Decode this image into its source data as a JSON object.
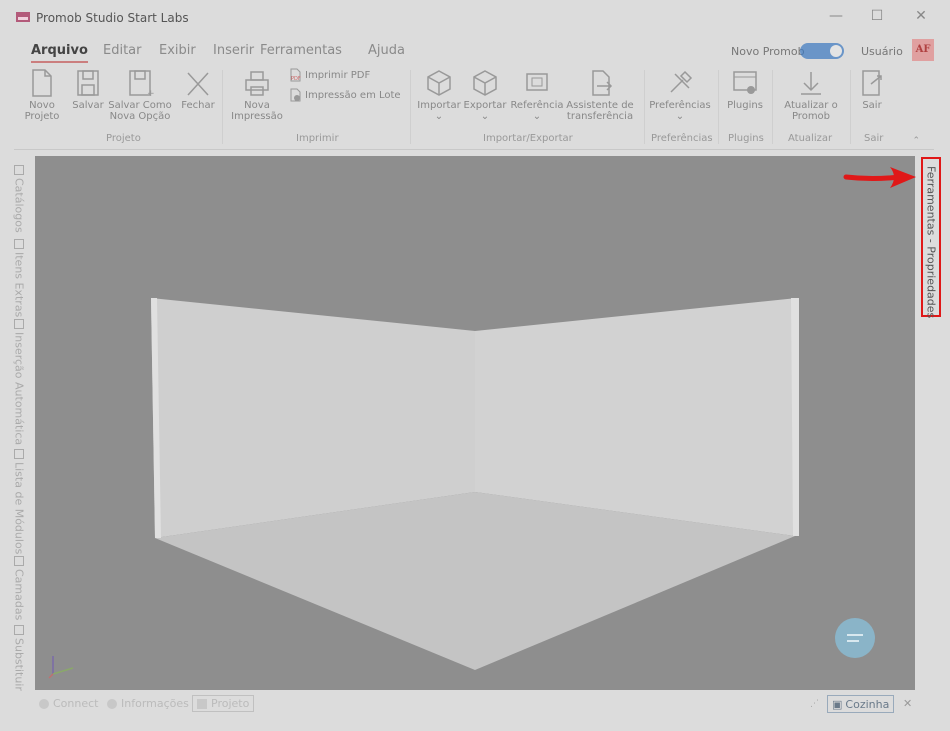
{
  "window": {
    "title": "Promob Studio Start Labs",
    "minimize": "—",
    "maximize": "☐",
    "close": "✕"
  },
  "menu": {
    "items": [
      "Arquivo",
      "Editar",
      "Exibir",
      "Inserir",
      "Ferramentas",
      "Ajuda"
    ],
    "novo_promob": "Novo Promob",
    "novo_promob_enabled": true,
    "user": "Usuário",
    "avatar": "AF"
  },
  "ribbon": {
    "projeto": {
      "novo": [
        "Novo",
        "Projeto"
      ],
      "salvar": "Salvar",
      "salvar_como": [
        "Salvar Como",
        "Nova Opção"
      ],
      "fechar": "Fechar",
      "group": "Projeto"
    },
    "imprimir": {
      "nova": [
        "Nova",
        "Impressão"
      ],
      "pdf": "Imprimir PDF",
      "lote": "Impressão em Lote",
      "group": "Imprimir"
    },
    "importar": {
      "importar": "Importar",
      "exportar": "Exportar",
      "referencia": "Referência",
      "assistente": [
        "Assistente de",
        "transferência"
      ],
      "group": "Importar/Exportar"
    },
    "preferencias": {
      "label": "Preferências",
      "group": "Preferências"
    },
    "plugins": {
      "label": "Plugins",
      "group": "Plugins"
    },
    "atualizar": {
      "label": [
        "Atualizar o",
        "Promob"
      ],
      "group": "Atualizar"
    },
    "sair": {
      "label": "Sair",
      "group": "Sair"
    }
  },
  "left_tabs": [
    "Catálogos",
    "Itens Extras",
    "Inserção Automática",
    "Lista de Módulos",
    "Camadas",
    "Substituir"
  ],
  "right_tab": {
    "label": "Ferramentas - Propriedades"
  },
  "bottom_tabs": [
    "Connect",
    "Informações",
    "Projeto"
  ],
  "bottom_active": "Projeto",
  "environment": {
    "label": "Cozinha",
    "close": "✕"
  },
  "colors": {
    "viewport_bg": "#8e8e8e",
    "wall": "#d2d2d2",
    "floor": "#c6c6c6",
    "highlight": "#e01818",
    "toggle": "#3a78c0"
  }
}
